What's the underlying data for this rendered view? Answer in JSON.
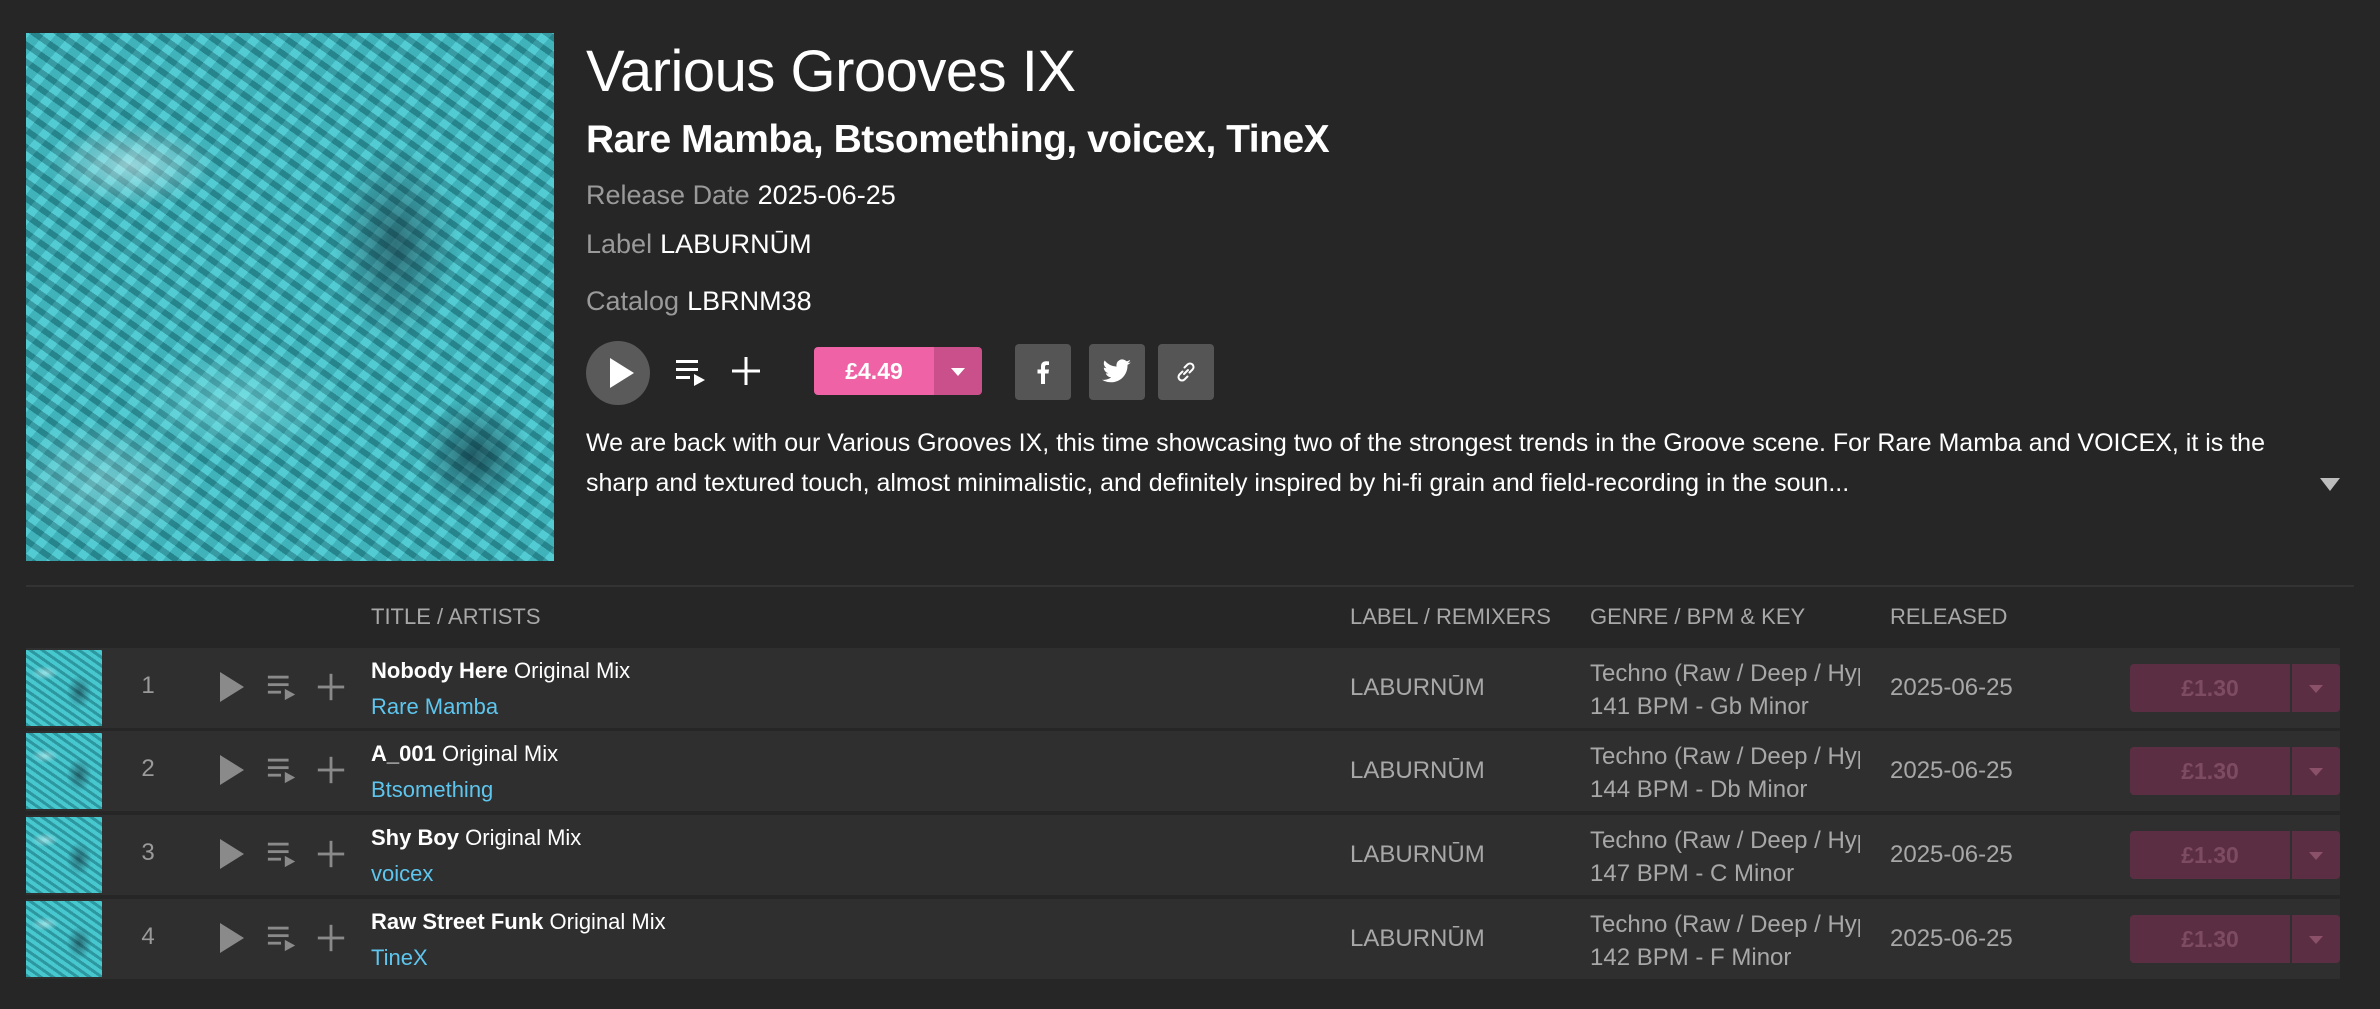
{
  "release": {
    "title": "Various Grooves IX",
    "artists": "Rare Mamba, Btsomething, voicex, TineX",
    "release_date_label": "Release Date",
    "release_date": "2025-06-25",
    "label_label": "Label",
    "label": "LABURNŪM",
    "catalog_label": "Catalog",
    "catalog": "LBRNM38",
    "price": "£4.49",
    "description": "We are back with our Various Grooves IX, this time showcasing two of the strongest trends in the Groove scene. For Rare Mamba and VOICEX, it is the sharp and textured touch, almost minimalistic, and definitely inspired by hi-fi grain and field-recording in the soun...",
    "cover_icon": "album-artwork-image"
  },
  "icons": {
    "play": "play-icon",
    "queue": "add-to-queue-icon",
    "add": "plus-icon",
    "facebook": "facebook-icon",
    "twitter": "twitter-icon",
    "link": "link-icon",
    "expand": "expand-caret-icon"
  },
  "colors": {
    "background": "#262626",
    "row_background": "#2f2f2f",
    "price_accent": "#ef63a6",
    "artist_link": "#5ec6ee"
  },
  "tracklist": {
    "headers": {
      "title": "TITLE / ARTISTS",
      "label": "LABEL / REMIXERS",
      "genre": "GENRE / BPM & KEY",
      "released": "RELEASED"
    },
    "tracks": [
      {
        "number": "1",
        "title": "Nobody Here",
        "mix": "Original Mix",
        "artist": "Rare Mamba",
        "label": "LABURNŪM",
        "genre": "Techno (Raw / Deep / Hypnotic)",
        "bpm_key": "141 BPM - Gb Minor",
        "released": "2025-06-25",
        "price": "£1.30"
      },
      {
        "number": "2",
        "title": "A_001",
        "mix": "Original Mix",
        "artist": "Btsomething",
        "label": "LABURNŪM",
        "genre": "Techno (Raw / Deep / Hypnotic)",
        "bpm_key": "144 BPM - Db Minor",
        "released": "2025-06-25",
        "price": "£1.30"
      },
      {
        "number": "3",
        "title": "Shy Boy",
        "mix": "Original Mix",
        "artist": "voicex",
        "label": "LABURNŪM",
        "genre": "Techno (Raw / Deep / Hypnotic)",
        "bpm_key": "147 BPM - C Minor",
        "released": "2025-06-25",
        "price": "£1.30"
      },
      {
        "number": "4",
        "title": "Raw Street Funk",
        "mix": "Original Mix",
        "artist": "TineX",
        "label": "LABURNŪM",
        "genre": "Techno (Raw / Deep / Hypnotic)",
        "bpm_key": "142 BPM - F Minor",
        "released": "2025-06-25",
        "price": "£1.30"
      }
    ]
  }
}
